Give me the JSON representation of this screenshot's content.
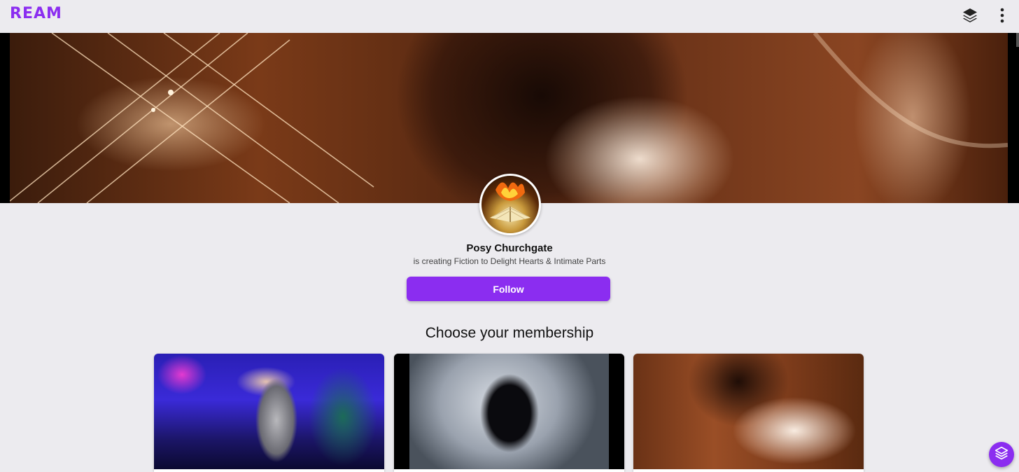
{
  "brand": {
    "logo_text": "REAM",
    "accent_color": "#8b2df0"
  },
  "topbar": {
    "icons": [
      "layers-icon",
      "more-vertical-icon"
    ]
  },
  "creator": {
    "name": "Posy Churchgate",
    "tagline": "is creating Fiction to Delight Hearts & Intimate Parts",
    "follow_label": "Follow"
  },
  "membership": {
    "title": "Choose your membership",
    "tiers": [
      {
        "image": "nightclub-dancer-image"
      },
      {
        "image": "couple-dancing-image"
      },
      {
        "image": "woman-smoke-art-image"
      }
    ]
  },
  "fab": {
    "icon": "layers-icon"
  }
}
